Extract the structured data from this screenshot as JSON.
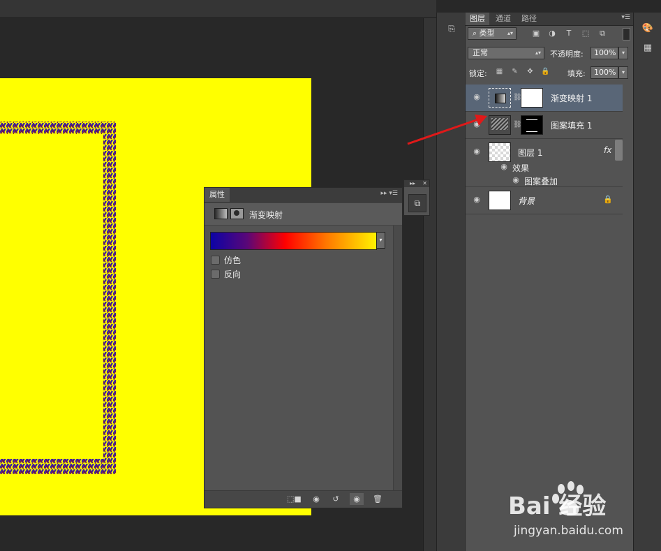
{
  "properties_panel": {
    "tab": "属性",
    "type_label": "渐变映射",
    "options": [
      {
        "label": "仿色",
        "checked": false
      },
      {
        "label": "反向",
        "checked": false
      }
    ]
  },
  "layers_panel": {
    "tabs": [
      "图层",
      "通道",
      "路径"
    ],
    "filter_kind": "类型",
    "blend_mode": "正常",
    "opacity_label": "不透明度:",
    "opacity_value": "100%",
    "lock_label": "锁定:",
    "fill_label": "填充:",
    "fill_value": "100%",
    "layers": [
      {
        "name": "渐变映射 1",
        "selected": true
      },
      {
        "name": "图案填充 1",
        "selected": false
      },
      {
        "name": "图层 1",
        "selected": false,
        "fx": "fx",
        "effects_label": "效果",
        "effect": "图案叠加"
      },
      {
        "name": "背景",
        "selected": false
      }
    ]
  },
  "watermark": {
    "brand": "Bai 经验",
    "url": "jingyan.baidu.com"
  },
  "colors": {
    "canvas": "#ffff00",
    "gradient_start": "#0c03a6",
    "gradient_mid": "#ff0000",
    "gradient_end": "#fff200",
    "selected_layer": "#596677",
    "arrow": "#e01919"
  }
}
